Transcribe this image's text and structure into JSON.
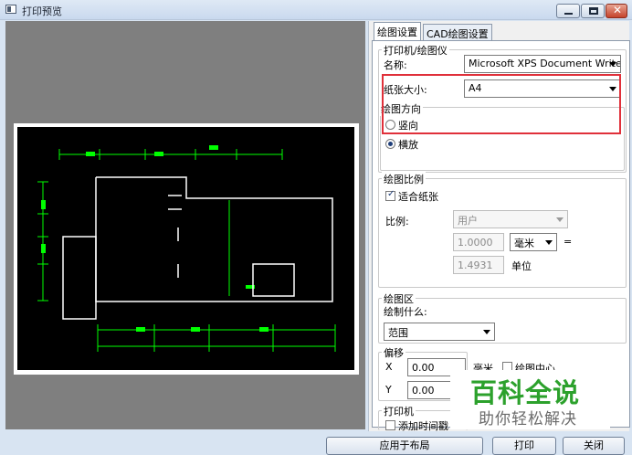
{
  "window": {
    "title": "打印预览"
  },
  "tabs": [
    "绘图设置",
    "CAD绘图设置"
  ],
  "printer_group": {
    "legend": "打印机/绘图仪",
    "name_label": "名称:",
    "name_value": "Microsoft XPS Document Writer",
    "paper_label": "纸张大小:",
    "paper_value": "A4"
  },
  "orientation_group": {
    "legend": "绘图方向",
    "portrait": "竖向",
    "landscape": "横放",
    "selected": "横放"
  },
  "scale_group": {
    "legend": "绘图比例",
    "fit_paper": "适合纸张",
    "fit_paper_checked": true,
    "scale_label": "比例:",
    "scale_value": "用户",
    "value1": "1.0000",
    "unit_combo": "毫米",
    "equals": "=",
    "value2": "1.4931",
    "unit_label": "单位"
  },
  "area_group": {
    "legend": "绘图区",
    "what_label": "绘制什么:",
    "what_value": "范围"
  },
  "offset_group": {
    "legend": "偏移",
    "x_label": "X",
    "x_value": "0.00",
    "x_unit": "毫米",
    "center_label": "绘图中心",
    "center_checked": false,
    "y_label": "Y",
    "y_value": "0.00"
  },
  "print_group": {
    "legend": "打印机",
    "timestamp_label": "添加时间戳"
  },
  "watermark": {
    "title": "百科全说",
    "subtitle": "助你轻松解决"
  },
  "buttons": {
    "apply_layout": "应用于布局",
    "print": "打印",
    "close": "关闭"
  },
  "colors": {
    "highlight": "#e0303a",
    "cad_lines": "#00ff00",
    "cad_walls": "#ffffff"
  }
}
